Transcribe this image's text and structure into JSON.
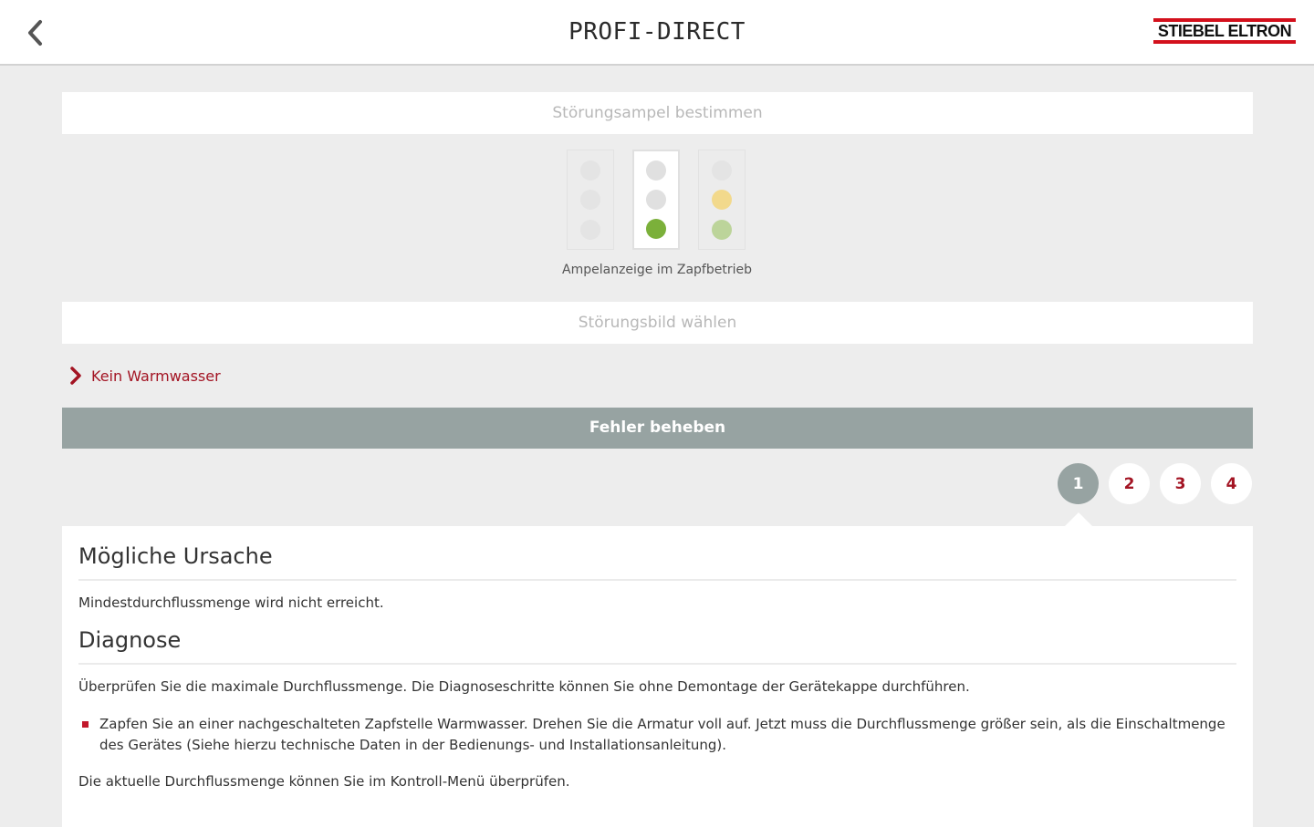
{
  "header": {
    "title": "PROFI-DIRECT",
    "brand": "STIEBEL ELTRON",
    "brand_color": "#d3101c"
  },
  "sections": {
    "traffic_light_title": "Störungsampel bestimmen",
    "fault_image_title": "Störungsbild wählen"
  },
  "traffic_lights": {
    "caption": "Ampelanzeige im Zapfbetrieb",
    "options": [
      {
        "colors": [
          "#e4e4e4",
          "#e4e4e4",
          "#e4e4e4"
        ],
        "selected": false
      },
      {
        "colors": [
          "#e0e0e0",
          "#e0e0e0",
          "#7bb03a"
        ],
        "selected": true
      },
      {
        "colors": [
          "#e4e4e4",
          "#f2d98c",
          "#bcd49a"
        ],
        "selected": false
      }
    ]
  },
  "issue": {
    "label": "Kein Warmwasser"
  },
  "fix_button": {
    "label": "Fehler beheben"
  },
  "steps": {
    "items": [
      "1",
      "2",
      "3",
      "4"
    ],
    "active": "1"
  },
  "content": {
    "cause_heading": "Mögliche Ursache",
    "cause_text": "Mindestdurchflussmenge wird nicht erreicht.",
    "diagnosis_heading": "Diagnose",
    "diagnosis_text": "Überprüfen Sie die maximale Durchflussmenge. Die Diagnoseschritte können Sie ohne Demontage der Gerätekappe durchführen.",
    "bullet": "Zapfen Sie an einer nachgeschalteten Zapfstelle Warmwasser. Drehen Sie die Armatur voll auf. Jetzt muss die Durchflussmenge größer sein, als die Einschaltmenge des Gerätes (Siehe hierzu technische Daten in der Bedienungs- und Installationsanleitung).",
    "footer_text": "Die aktuelle Durchflussmenge können Sie im Kontroll-Menü überprüfen."
  },
  "colors": {
    "accent_red": "#a31423",
    "grey_button": "#97a3a2"
  }
}
